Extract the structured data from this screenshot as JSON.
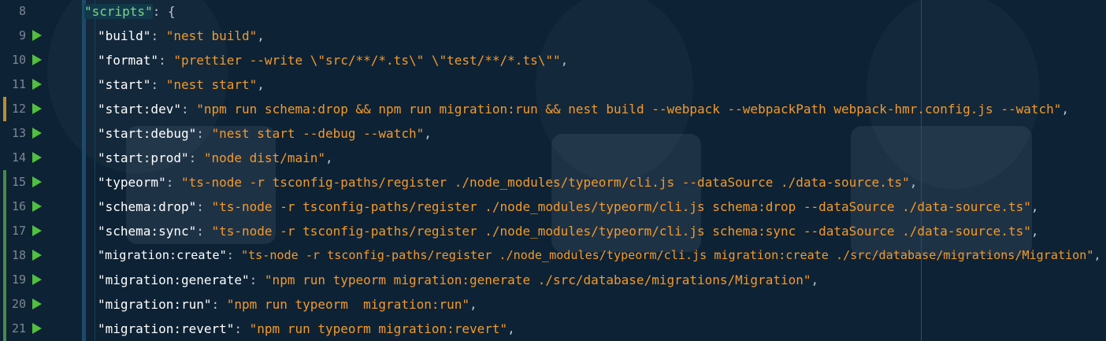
{
  "editor": {
    "accent": {
      "background": "#0d2235",
      "key_color": "#ffffff",
      "string_color": "#f39a28",
      "line_number_color": "#7c8793",
      "run_icon_color": "#4fc13a",
      "modified_marker": "#c08a2d",
      "added_marker": "#4a8a45"
    },
    "lines": [
      {
        "num": "8",
        "key": "\"scripts\"",
        "value": "",
        "tail": ": {",
        "run": false,
        "marker": "none"
      },
      {
        "num": "9",
        "key": "\"build\"",
        "value": "\"nest build\"",
        "tail": ",",
        "run": true,
        "marker": "none"
      },
      {
        "num": "10",
        "key": "\"format\"",
        "value": "\"prettier --write \\\"src/**/*.ts\\\" \\\"test/**/*.ts\\\"\"",
        "tail": ",",
        "run": true,
        "marker": "none"
      },
      {
        "num": "11",
        "key": "\"start\"",
        "value": "\"nest start\"",
        "tail": ",",
        "run": true,
        "marker": "none"
      },
      {
        "num": "12",
        "key": "\"start:dev\"",
        "value": "\"npm run schema:drop && npm run migration:run && nest build --webpack --webpackPath webpack-hmr.config.js --watch\"",
        "tail": ",",
        "run": true,
        "marker": "modified"
      },
      {
        "num": "13",
        "key": "\"start:debug\"",
        "value": "\"nest start --debug --watch\"",
        "tail": ",",
        "run": true,
        "marker": "none"
      },
      {
        "num": "14",
        "key": "\"start:prod\"",
        "value": "\"node dist/main\"",
        "tail": ",",
        "run": true,
        "marker": "none"
      },
      {
        "num": "15",
        "key": "\"typeorm\"",
        "value": "\"ts-node -r tsconfig-paths/register ./node_modules/typeorm/cli.js --dataSource ./data-source.ts\"",
        "tail": ",",
        "run": true,
        "marker": "added"
      },
      {
        "num": "16",
        "key": "\"schema:drop\"",
        "value": "\"ts-node -r tsconfig-paths/register ./node_modules/typeorm/cli.js schema:drop --dataSource ./data-source.ts\"",
        "tail": ",",
        "run": true,
        "marker": "added"
      },
      {
        "num": "17",
        "key": "\"schema:sync\"",
        "value": "\"ts-node -r tsconfig-paths/register ./node_modules/typeorm/cli.js schema:sync --dataSource ./data-source.ts\"",
        "tail": ",",
        "run": true,
        "marker": "added"
      },
      {
        "num": "18",
        "key": "\"migration:create\"",
        "value": "\"ts-node -r tsconfig-paths/register ./node_modules/typeorm/cli.js migration:create ./src/database/migrations/Migration\"",
        "tail": ",",
        "run": true,
        "marker": "added"
      },
      {
        "num": "19",
        "key": "\"migration:generate\"",
        "value": "\"npm run typeorm migration:generate ./src/database/migrations/Migration\"",
        "tail": ",",
        "run": true,
        "marker": "added"
      },
      {
        "num": "20",
        "key": "\"migration:run\"",
        "value": "\"npm run typeorm  migration:run\"",
        "tail": ",",
        "run": true,
        "marker": "added"
      },
      {
        "num": "21",
        "key": "\"migration:revert\"",
        "value": "\"npm run typeorm migration:revert\"",
        "tail": ",",
        "run": true,
        "marker": "added"
      }
    ]
  }
}
